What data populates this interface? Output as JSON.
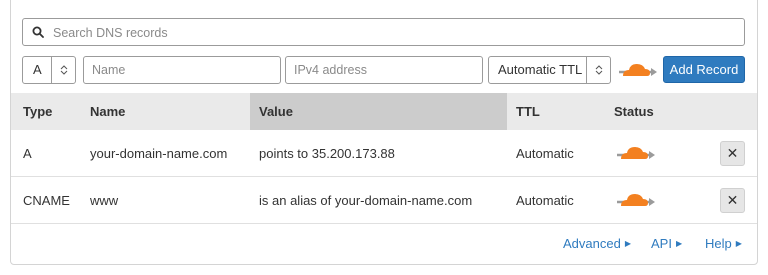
{
  "search": {
    "placeholder": "Search DNS records",
    "icon": "search-icon"
  },
  "controls": {
    "type_value": "A",
    "name_placeholder": "Name",
    "ipv4_placeholder": "IPv4 address",
    "ttl_value": "Automatic TTL",
    "proxy_icon": "cloud-proxied-icon",
    "add_label": "Add Record"
  },
  "table": {
    "headers": [
      "Type",
      "Name",
      "Value",
      "TTL",
      "Status"
    ],
    "rows": [
      {
        "type": "A",
        "name": "your-domain-name.com",
        "value": "points to 35.200.173.88",
        "ttl": "Automatic",
        "status_icon": "cloud-proxied-icon",
        "delete_label": "✕"
      },
      {
        "type": "CNAME",
        "name": "www",
        "value": "is an alias of your-domain-name.com",
        "ttl": "Automatic",
        "status_icon": "cloud-proxied-icon",
        "delete_label": "✕"
      }
    ]
  },
  "footer": {
    "links": [
      "Advanced",
      "API",
      "Help"
    ]
  },
  "colors": {
    "accent": "#2f7bbf",
    "cloud": "#f38020",
    "arrow": "#9b9b9b"
  }
}
